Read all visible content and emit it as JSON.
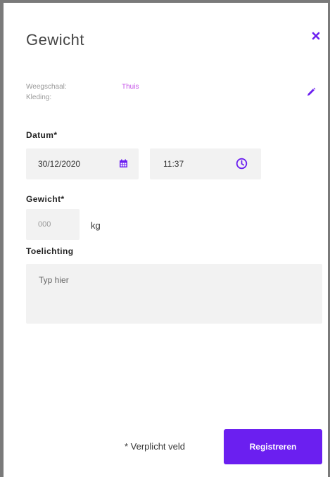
{
  "dialog": {
    "title": "Gewicht",
    "close_icon": "close-icon"
  },
  "meta": {
    "scale_label": "Weegschaal:",
    "scale_value": "Thuis",
    "clothing_label": "Kleding:",
    "clothing_value": "",
    "edit_icon": "pencil-icon"
  },
  "date_section": {
    "label": "Datum*",
    "date_value": "30/12/2020",
    "date_icon": "calendar-icon",
    "time_value": "11:37",
    "time_icon": "clock-icon"
  },
  "weight_section": {
    "label": "Gewicht*",
    "placeholder": "000",
    "unit": "kg"
  },
  "note_section": {
    "label": "Toelichting",
    "placeholder": "Typ hier"
  },
  "footer": {
    "required_note": "* Verplicht veld",
    "submit_label": "Registreren"
  },
  "colors": {
    "accent": "#6b1ff0",
    "scale_value": "#c552e8",
    "field_bg": "#f2f2f2"
  }
}
